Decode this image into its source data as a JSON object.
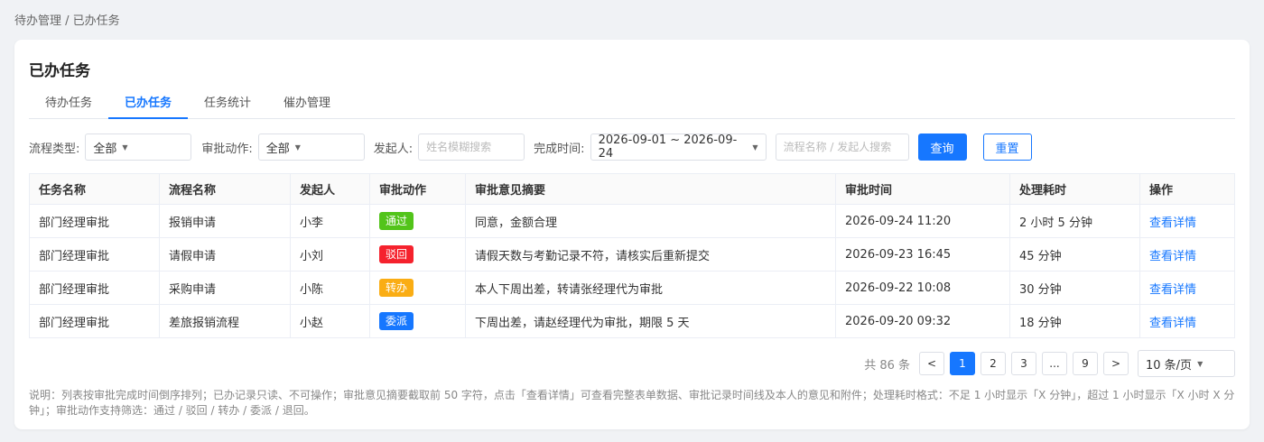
{
  "breadcrumb": "待办管理 / 已办任务",
  "title": "已办任务",
  "tabs": [
    "待办任务",
    "已办任务",
    "任务统计",
    "催办管理"
  ],
  "filters": {
    "type_label": "流程类型:",
    "type_value": "全部",
    "action_label": "审批动作:",
    "action_value": "全部",
    "initiator_label": "发起人:",
    "initiator_placeholder": "姓名模糊搜索",
    "time_label": "完成时间:",
    "time_value": "2026-09-01 ~ 2026-09-24",
    "search_placeholder": "流程名称 / 发起人搜索",
    "query_label": "查询",
    "reset_label": "重置"
  },
  "table": {
    "headers": [
      "任务名称",
      "流程名称",
      "发起人",
      "审批动作",
      "审批意见摘要",
      "审批时间",
      "处理耗时",
      "操作"
    ],
    "rows": [
      {
        "task": "部门经理审批",
        "flow": "报销申请",
        "initiator": "小李",
        "action": "通过",
        "action_color": "#52c41a",
        "opinion": "同意，金额合理",
        "time": "2026-09-24 11:20",
        "duration": "2 小时 5 分钟",
        "op": "查看详情"
      },
      {
        "task": "部门经理审批",
        "flow": "请假申请",
        "initiator": "小刘",
        "action": "驳回",
        "action_color": "#f5222d",
        "opinion": "请假天数与考勤记录不符，请核实后重新提交",
        "time": "2026-09-23 16:45",
        "duration": "45 分钟",
        "op": "查看详情"
      },
      {
        "task": "部门经理审批",
        "flow": "采购申请",
        "initiator": "小陈",
        "action": "转办",
        "action_color": "#faad14",
        "opinion": "本人下周出差，转请张经理代为审批",
        "time": "2026-09-22 10:08",
        "duration": "30 分钟",
        "op": "查看详情"
      },
      {
        "task": "部门经理审批",
        "flow": "差旅报销流程",
        "initiator": "小赵",
        "action": "委派",
        "action_color": "#1677ff",
        "opinion": "下周出差，请赵经理代为审批，期限 5 天",
        "time": "2026-09-20 09:32",
        "duration": "18 分钟",
        "op": "查看详情"
      }
    ]
  },
  "pagination": {
    "total": "共 86 条",
    "prev": "<",
    "pages": [
      "1",
      "2",
      "3",
      "...",
      "9"
    ],
    "next": ">",
    "page_size": "10 条/页"
  },
  "note": "说明：列表按审批完成时间倒序排列；已办记录只读、不可操作；审批意见摘要截取前 50 字符，点击「查看详情」可查看完整表单数据、审批记录时间线及本人的意见和附件；处理耗时格式：不足 1 小时显示「X 分钟」，超过 1 小时显示「X 小时 X 分钟」；审批动作支持筛选：通过 / 驳回 / 转办 / 委派 / 退回。"
}
